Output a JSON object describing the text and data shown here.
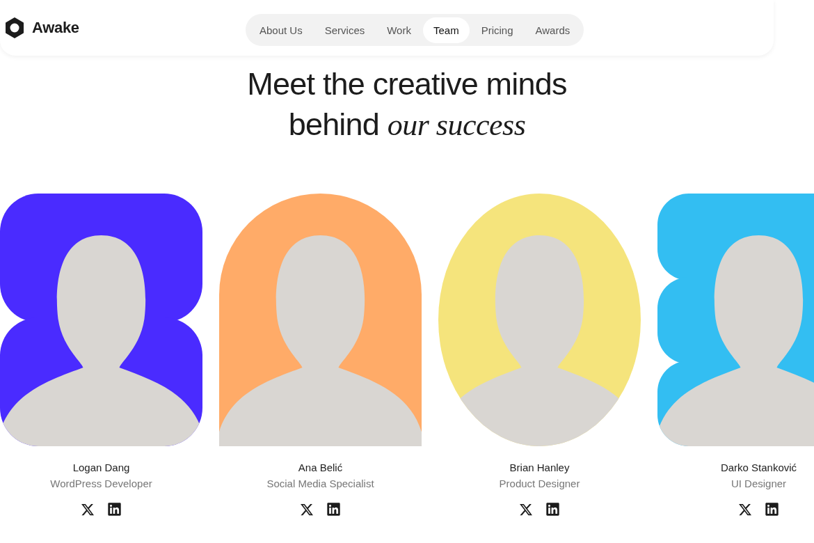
{
  "brand": {
    "name": "Awake"
  },
  "nav": [
    {
      "label": "About Us",
      "selected": false
    },
    {
      "label": "Services",
      "selected": false
    },
    {
      "label": "Work",
      "selected": false
    },
    {
      "label": "Team",
      "selected": true
    },
    {
      "label": "Pricing",
      "selected": false
    },
    {
      "label": "Awards",
      "selected": false
    }
  ],
  "heading": {
    "line_1": "Meet the creative minds",
    "line_2": "behind *our success*"
  },
  "members": [
    {
      "name": "Logan Dang",
      "role": "WordPress Developer",
      "kind": "blob",
      "color": "#4a2bff",
      "socials": [
        {
          "kind": "x"
        },
        {
          "kind": "linkedin"
        }
      ]
    },
    {
      "name": "Ana Belić",
      "role": "Social Media Specialist",
      "kind": "arch",
      "color": "#ffab68",
      "socials": [
        {
          "kind": "x"
        },
        {
          "kind": "linkedin"
        }
      ]
    },
    {
      "name": "Brian Hanley",
      "role": "Product Designer",
      "kind": "oval",
      "color": "#f5e47c",
      "socials": [
        {
          "kind": "x"
        },
        {
          "kind": "linkedin"
        }
      ]
    },
    {
      "name": "Darko Stanković",
      "role": "UI Designer",
      "kind": "stack",
      "color": "#33bef2",
      "socials": [
        {
          "kind": "x"
        },
        {
          "kind": "linkedin"
        }
      ]
    }
  ]
}
